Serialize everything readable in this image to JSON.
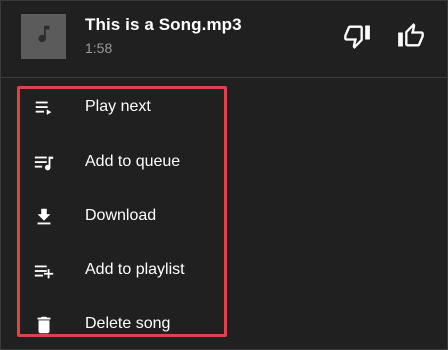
{
  "song": {
    "title": "This is a Song.mp3",
    "duration": "1:58",
    "thumbnail_icon": "music-note-icon"
  },
  "actions": {
    "dislike_icon": "thumbs-down-icon",
    "like_icon": "thumbs-up-icon"
  },
  "menu": {
    "items": [
      {
        "label": "Play next",
        "icon": "play-next-icon"
      },
      {
        "label": "Add to queue",
        "icon": "add-to-queue-icon"
      },
      {
        "label": "Download",
        "icon": "download-icon"
      },
      {
        "label": "Add to playlist",
        "icon": "add-to-playlist-icon"
      },
      {
        "label": "Delete song",
        "icon": "trash-icon"
      }
    ]
  },
  "colors": {
    "background": "#202020",
    "highlight_border": "#e0414a",
    "secondary_text": "#9a9a9a"
  }
}
